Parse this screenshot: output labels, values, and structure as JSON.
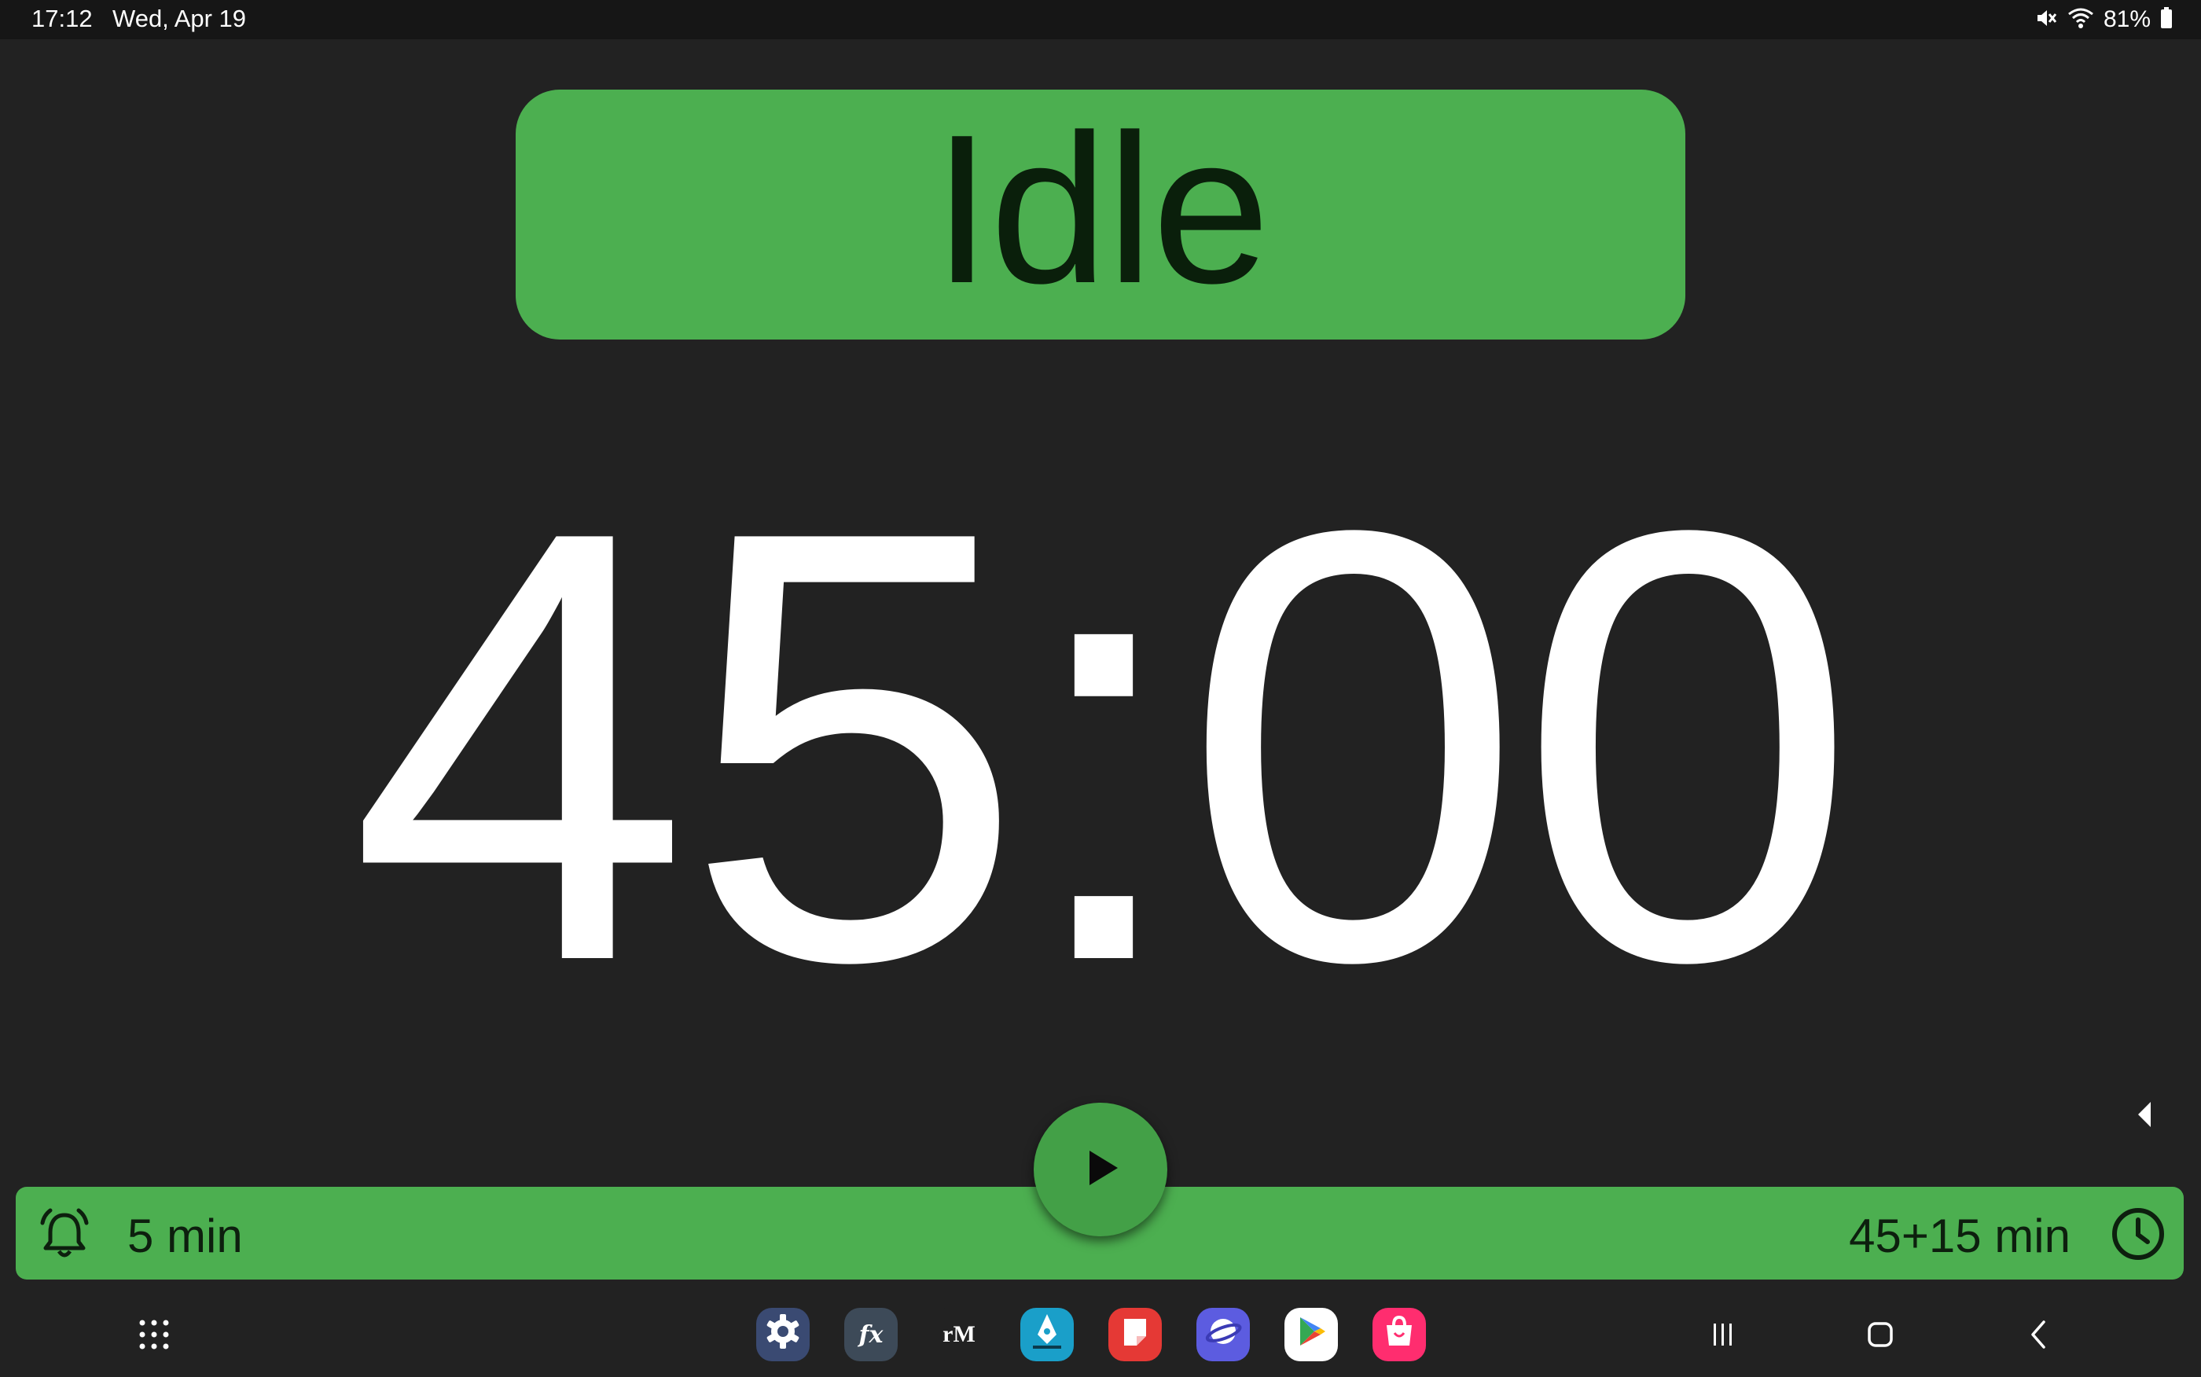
{
  "status_bar": {
    "time": "17:12",
    "date": "Wed, Apr 19",
    "battery": "81%",
    "icons": [
      "mute-icon",
      "wifi-icon",
      "battery-icon"
    ]
  },
  "timer": {
    "state": "Idle",
    "remaining": "45:00"
  },
  "bottom_bar": {
    "break_label": "5 min",
    "duration_label": "45+15 min",
    "icons": [
      "bell-icon",
      "clock-icon"
    ]
  },
  "play_button": {
    "icon": "play-icon"
  },
  "dock": {
    "apps": [
      {
        "name": "settings",
        "icon": "gear-icon"
      },
      {
        "name": "fx",
        "label": "fx"
      },
      {
        "name": "remarkable",
        "label": "rM"
      },
      {
        "name": "pen-app",
        "icon": "pen-nib-icon"
      },
      {
        "name": "notes",
        "icon": "note-icon"
      },
      {
        "name": "internet",
        "icon": "planet-icon"
      },
      {
        "name": "play-store",
        "icon": "play-store-icon"
      },
      {
        "name": "galaxy-store",
        "icon": "shopping-bag-icon"
      }
    ]
  },
  "colors": {
    "accent_green": "#4caf50",
    "fab_green": "#43a047",
    "background": "#222222",
    "text_dark": "#0a1f0b"
  }
}
